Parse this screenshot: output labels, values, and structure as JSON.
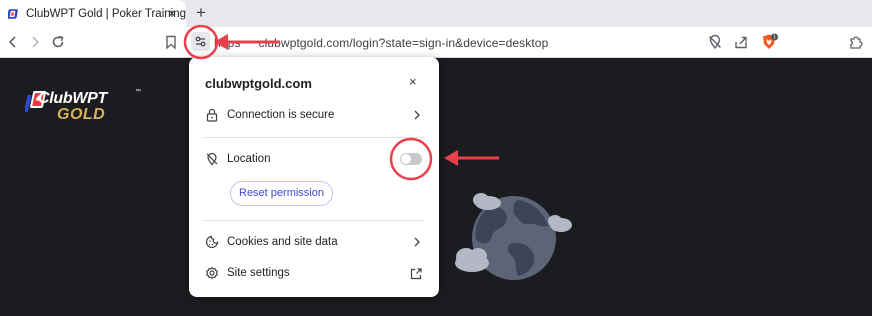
{
  "tab": {
    "title": "ClubWPT Gold | Poker Training",
    "close_glyph": "×",
    "new_tab_glyph": "+"
  },
  "address_bar": {
    "url_prefix": "https",
    "url_rest": "clubwptgold.com/login?state=sign-in&device=desktop"
  },
  "page": {
    "logo_name": "ClubWPT",
    "logo_tm": "™",
    "logo_gold": "GOLD"
  },
  "popup": {
    "domain": "clubwptgold.com",
    "close_glyph": "×",
    "connection_label": "Connection is secure",
    "location_label": "Location",
    "location_enabled": false,
    "reset_label": "Reset permission",
    "cookies_label": "Cookies and site data",
    "settings_label": "Site settings"
  },
  "colors": {
    "annotation": "#e8414e",
    "page_background": "#1b1c1f",
    "logo_gold": "#d8b15a",
    "reset_text": "#3c4bd6"
  },
  "icons": {
    "back": "back-arrow-icon",
    "forward": "forward-arrow-icon",
    "reload": "reload-icon",
    "bookmark": "bookmark-icon",
    "site_info": "site-info-tune-icon",
    "location_off": "location-off-icon",
    "share": "share-icon",
    "brave": "brave-shield-icon",
    "extensions": "puzzle-extension-icon",
    "lock": "lock-icon",
    "cookie": "cookie-icon",
    "gear": "gear-icon",
    "external": "open-external-icon"
  }
}
